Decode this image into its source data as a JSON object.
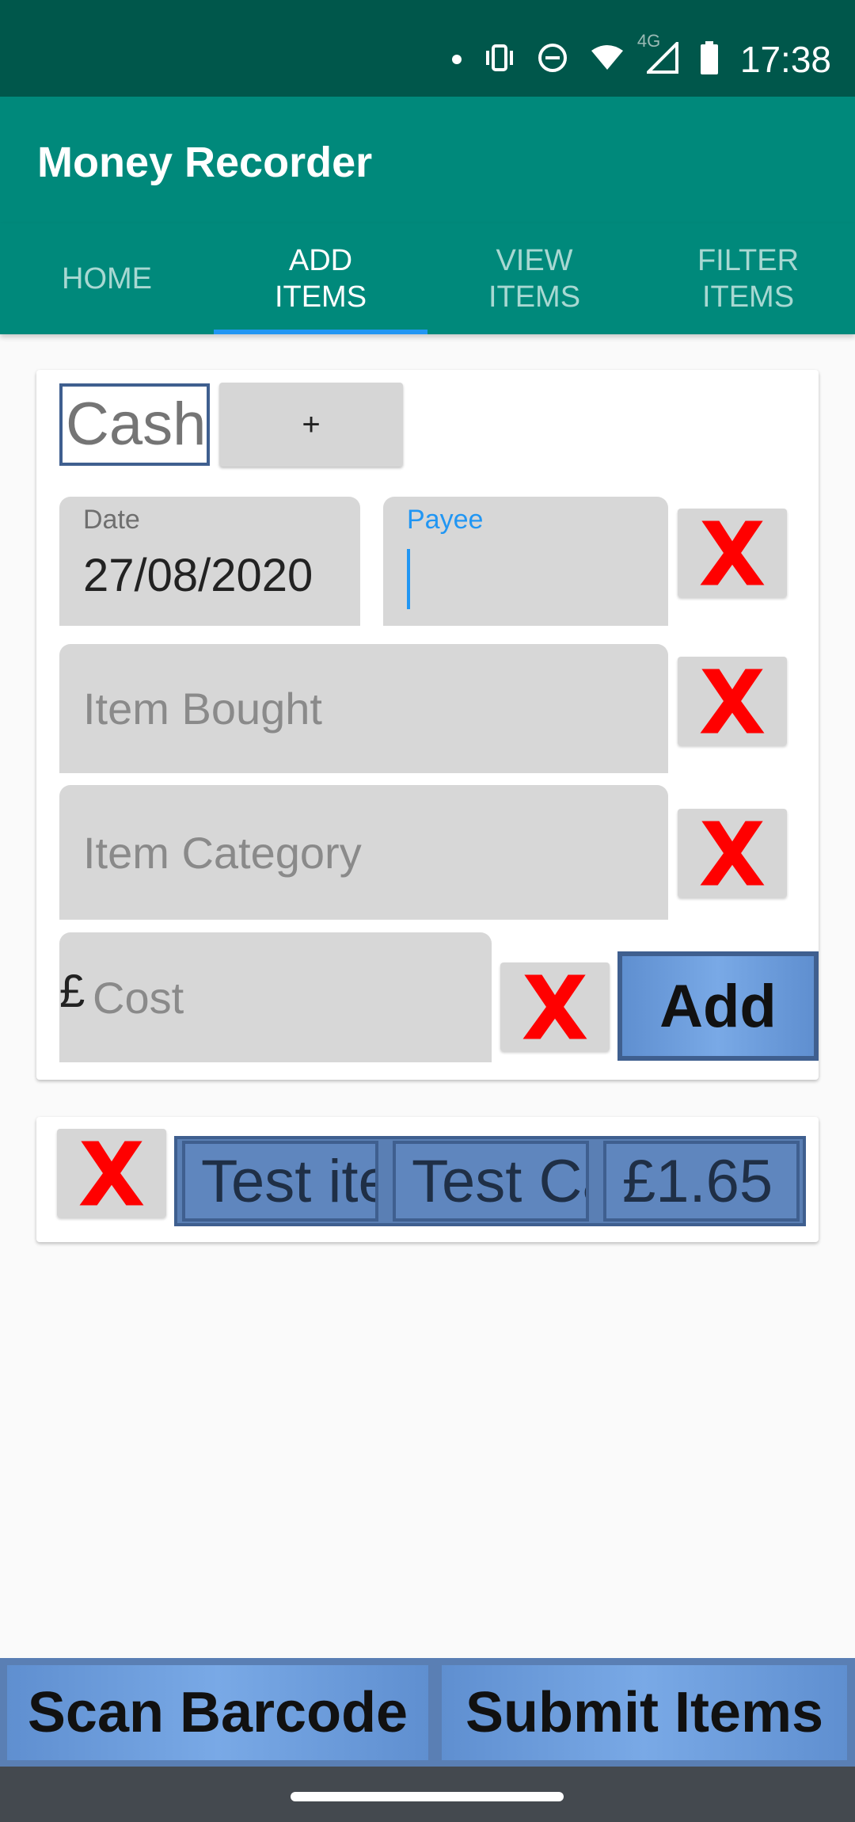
{
  "status_bar": {
    "time": "17:38",
    "network_label": "4G",
    "icons": [
      "notification-dot",
      "vibrate-icon",
      "do-not-disturb-icon",
      "wifi-icon",
      "signal-icon",
      "battery-icon"
    ]
  },
  "app": {
    "title": "Money Recorder"
  },
  "tabs": [
    {
      "label": "HOME",
      "active": false
    },
    {
      "label": "ADD\nITEMS",
      "active": true
    },
    {
      "label": "VIEW\nITEMS",
      "active": false
    },
    {
      "label": "FILTER\nITEMS",
      "active": false
    }
  ],
  "form": {
    "payment_method": "Cash",
    "add_method_label": "+",
    "date_label": "Date",
    "date_value": "27/08/2020",
    "payee_label": "Payee",
    "payee_value": "",
    "item_bought_placeholder": "Item Bought",
    "item_category_placeholder": "Item Category",
    "currency_symbol": "£",
    "cost_placeholder": "Cost",
    "add_label": "Add",
    "clear_icon": "close-icon"
  },
  "items": [
    {
      "name": "Test item",
      "category": "Test Category",
      "cost": "£1.65"
    }
  ],
  "bottom": {
    "scan_label": "Scan Barcode",
    "submit_label": "Submit Items"
  },
  "colors": {
    "status_bar": "#00574b",
    "app_bar": "#00897b",
    "tab_indicator": "#2196f3",
    "clear_x": "#ff0000",
    "button_blue": "#6f9fdf",
    "button_border": "#3f5f8f"
  }
}
